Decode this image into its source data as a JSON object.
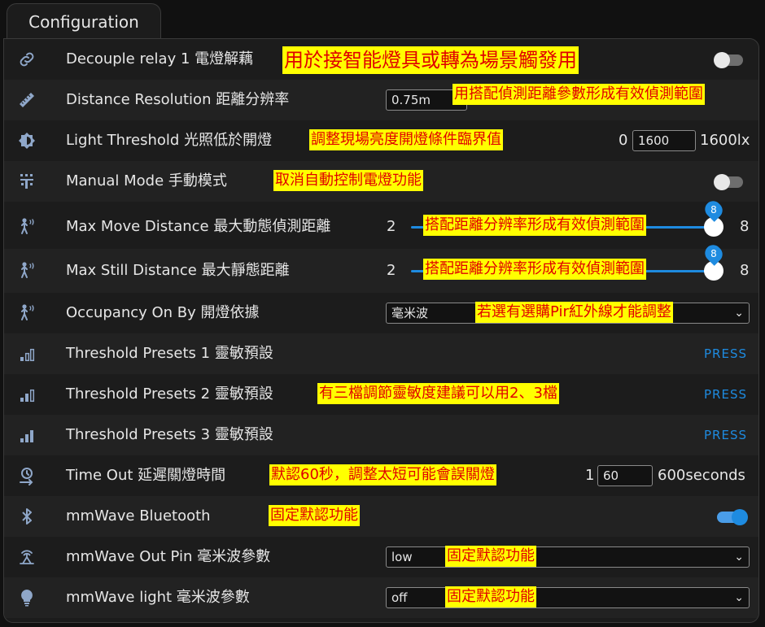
{
  "tab": {
    "label": "Configuration"
  },
  "rows": [
    {
      "icon": "link-icon",
      "label": "Decouple relay 1 電燈解藕",
      "control": "toggle",
      "state": "off",
      "annotation": "用於接智能燈具或轉為場景觸發用"
    },
    {
      "icon": "ruler-icon",
      "label": "Distance Resolution 距離分辨率",
      "control": "select",
      "value": "0.75m",
      "annotation": "用搭配偵測距離參數形成有效偵測範圍"
    },
    {
      "icon": "brightness-icon",
      "label": "Light Threshold 光照低於開燈",
      "control": "number",
      "min": "0",
      "value": "1600",
      "max": "1600lx",
      "annotation": "調整現場亮度開燈條件臨界值"
    },
    {
      "icon": "manual-icon",
      "label": "Manual Mode 手動模式",
      "control": "toggle",
      "state": "off",
      "annotation": "取消自動控制電燈功能"
    },
    {
      "icon": "motion-sensor-icon",
      "label": "Max Move Distance 最大動態偵測距離",
      "control": "slider",
      "min": "2",
      "value": "8",
      "max": "8",
      "annotation": "搭配距離分辨率形成有效偵測範圍"
    },
    {
      "icon": "motion-sensor-icon",
      "label": "Max Still Distance 最大靜態距離",
      "control": "slider",
      "min": "2",
      "value": "8",
      "max": "8",
      "annotation": "搭配距離分辨率形成有效偵測範圍"
    },
    {
      "icon": "motion-sensor-icon",
      "label": "Occupancy On By 開燈依據",
      "control": "select",
      "value": "毫米波",
      "annotation": "若選有選購Pir紅外線才能調整"
    },
    {
      "icon": "signal-1-icon",
      "label": "Threshold Presets 1 靈敏預設",
      "control": "button",
      "button": "PRESS"
    },
    {
      "icon": "signal-2-icon",
      "label": "Threshold Presets 2 靈敏預設",
      "control": "button",
      "button": "PRESS",
      "annotation": "有三檔調節靈敏度建議可以用2、3檔"
    },
    {
      "icon": "signal-3-icon",
      "label": "Threshold Presets 3 靈敏預設",
      "control": "button",
      "button": "PRESS"
    },
    {
      "icon": "timer-icon",
      "label": "Time Out 延遲關燈時間",
      "control": "number",
      "min": "1",
      "value": "60",
      "max": "600seconds",
      "annotation": "默認60秒，調整太短可能會誤關燈"
    },
    {
      "icon": "bluetooth-icon",
      "label": "mmWave Bluetooth",
      "control": "toggle",
      "state": "on",
      "annotation": "固定默認功能"
    },
    {
      "icon": "radar-icon",
      "label": "mmWave Out Pin 毫米波參數",
      "control": "select",
      "value": "low",
      "annotation": "固定默認功能"
    },
    {
      "icon": "lightbulb-icon",
      "label": "mmWave light 毫米波參數",
      "control": "select",
      "value": "off",
      "annotation": "固定默認功能"
    }
  ]
}
